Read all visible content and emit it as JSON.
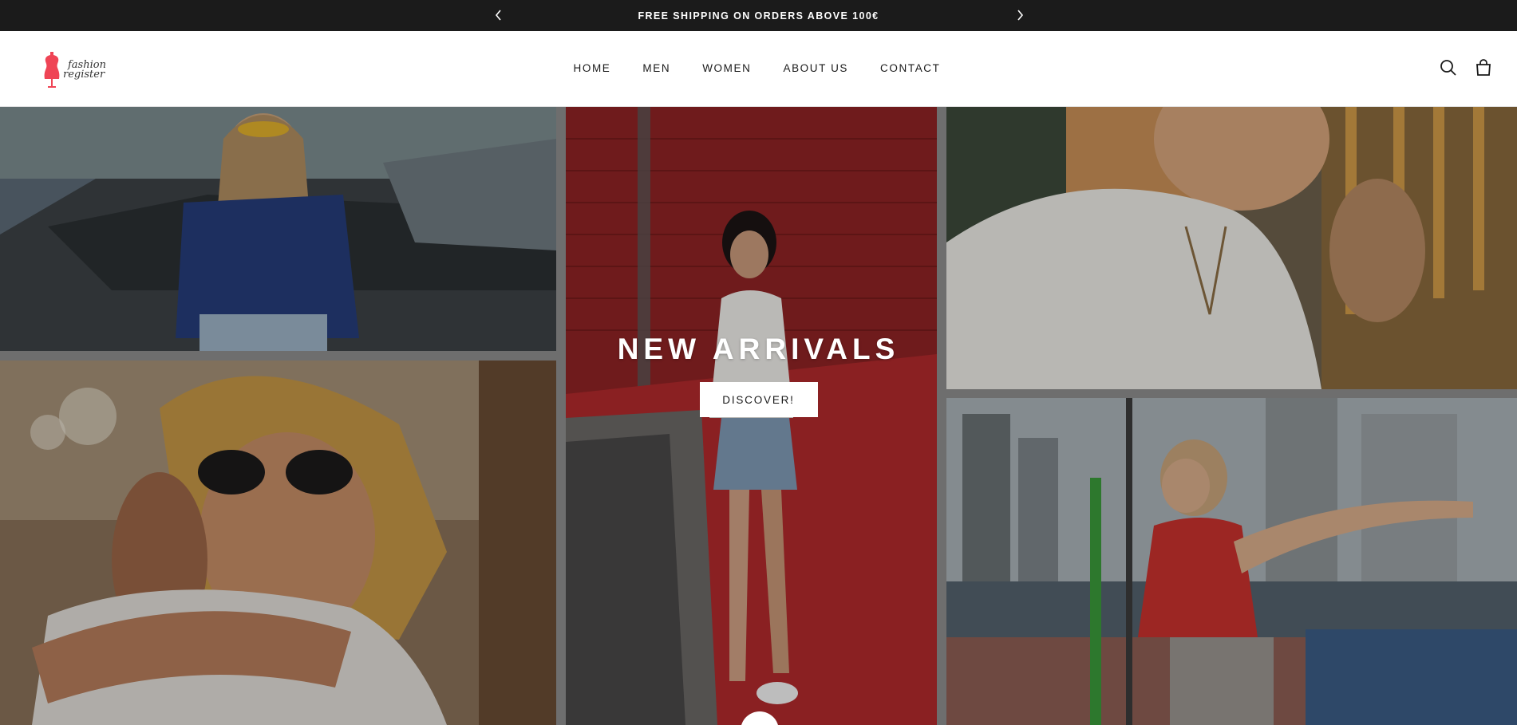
{
  "announcement": {
    "message": "FREE SHIPPING ON ORDERS ABOVE 100€",
    "prev_icon": "chevron-left-icon",
    "next_icon": "chevron-right-icon"
  },
  "header": {
    "logo": {
      "line1": "fashion",
      "line2": "register",
      "accent_color": "#ef4455"
    },
    "nav": [
      "HOME",
      "MEN",
      "WOMEN",
      "ABOUT US",
      "CONTACT"
    ],
    "icons": [
      "search-icon",
      "bag-icon"
    ]
  },
  "hero": {
    "title": "NEW ARRIVALS",
    "button_label": "DISCOVER!"
  },
  "colors": {
    "announcement_bg": "#1b1b1b",
    "header_bg": "#ffffff",
    "text": "#1a1a1a"
  }
}
